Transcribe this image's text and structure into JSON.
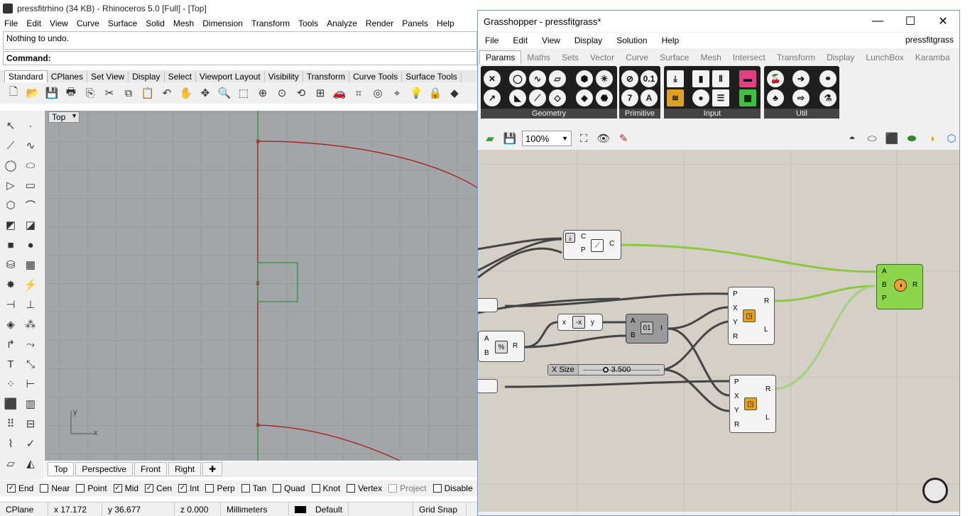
{
  "rhino": {
    "title": "pressfitrhino (34 KB) - Rhinoceros 5.0 [Full] - [Top]",
    "menu": [
      "File",
      "Edit",
      "View",
      "Curve",
      "Surface",
      "Solid",
      "Mesh",
      "Dimension",
      "Transform",
      "Tools",
      "Analyze",
      "Render",
      "Panels",
      "Help"
    ],
    "history": "Nothing to undo.",
    "command_label": "Command:",
    "toolbar_tabs": [
      "Standard",
      "CPlanes",
      "Set View",
      "Display",
      "Select",
      "Viewport Layout",
      "Visibility",
      "Transform",
      "Curve Tools",
      "Surface Tools"
    ],
    "viewport_label": "Top",
    "axis_x": "x",
    "axis_y": "y",
    "view_tabs": [
      "Top",
      "Perspective",
      "Front",
      "Right"
    ],
    "osnaps": [
      {
        "label": "End",
        "checked": true
      },
      {
        "label": "Near",
        "checked": false
      },
      {
        "label": "Point",
        "checked": false
      },
      {
        "label": "Mid",
        "checked": true
      },
      {
        "label": "Cen",
        "checked": true
      },
      {
        "label": "Int",
        "checked": true
      },
      {
        "label": "Perp",
        "checked": false
      },
      {
        "label": "Tan",
        "checked": false
      },
      {
        "label": "Quad",
        "checked": false
      },
      {
        "label": "Knot",
        "checked": false
      },
      {
        "label": "Vertex",
        "checked": false
      },
      {
        "label": "Project",
        "checked": false,
        "disabled": true
      },
      {
        "label": "Disable",
        "checked": false
      }
    ],
    "status": {
      "cplane": "CPlane",
      "x": "x 17.172",
      "y": "y 36.677",
      "z": "z 0.000",
      "units": "Millimeters",
      "layer": "Default",
      "grid_snap": "Grid Snap"
    },
    "colors": {
      "curve": "#aa1111",
      "x_axis": "#b00000",
      "y_axis": "#1a8a1a",
      "rect": "#1a8a1a"
    }
  },
  "grasshopper": {
    "title": "Grasshopper - pressfitgrass*",
    "menu": [
      "File",
      "Edit",
      "View",
      "Display",
      "Solution",
      "Help"
    ],
    "document": "pressfitgrass",
    "tabs": [
      "Params",
      "Maths",
      "Sets",
      "Vector",
      "Curve",
      "Surface",
      "Mesh",
      "Intersect",
      "Transform",
      "Display",
      "LunchBox",
      "Karamba"
    ],
    "groups": [
      "Geometry",
      "Primitive",
      "Input",
      "Util"
    ],
    "zoom": "100%",
    "components": {
      "pull": {
        "in": [
          "C",
          "P"
        ],
        "out": "C"
      },
      "negative": {
        "in": "x",
        "out": "y"
      },
      "division": {
        "in": [
          "A",
          "B"
        ],
        "out": "R"
      },
      "larger": {
        "in": [
          "A",
          "B"
        ],
        "out": "I"
      },
      "rect1": {
        "in": [
          "P",
          "X",
          "Y",
          "R"
        ],
        "out": [
          "R",
          "L"
        ]
      },
      "rect2": {
        "in": [
          "P",
          "X",
          "Y",
          "R"
        ],
        "out": [
          "R",
          "L"
        ]
      },
      "region": {
        "in": [
          "A",
          "B",
          "P"
        ],
        "out": "R"
      },
      "slider": {
        "label": "X Size",
        "value": "3.500"
      }
    }
  }
}
